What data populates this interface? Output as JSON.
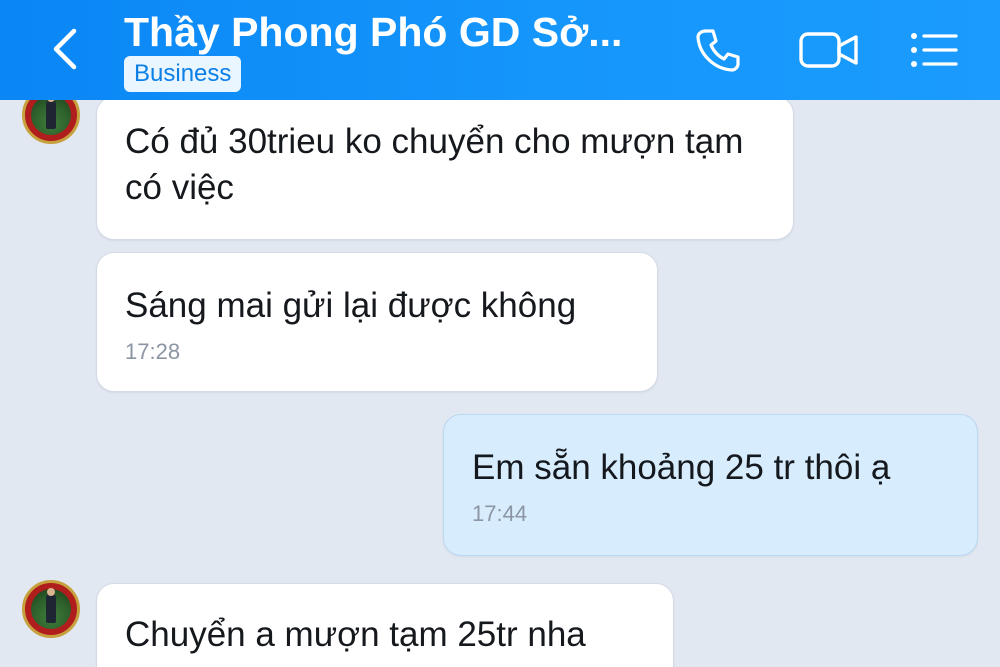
{
  "header": {
    "title": "Thầy Phong Phó GD Sở...",
    "badge": "Business",
    "back_icon": "chevron-left-icon",
    "call_icon": "phone-icon",
    "video_icon": "video-camera-icon",
    "menu_icon": "list-menu-icon"
  },
  "colors": {
    "header_blue": "#0a86f5",
    "chat_background": "#e2e8f1",
    "incoming_bubble": "#ffffff",
    "outgoing_bubble": "#d7ecfd"
  },
  "messages": [
    {
      "from": "contact",
      "text": "Có đủ 30trieu ko chuyển cho mượn tạm có việc",
      "time": ""
    },
    {
      "from": "contact",
      "text": "Sáng mai gửi lại được không",
      "time": "17:28"
    },
    {
      "from": "me",
      "text": "Em sẵn khoảng 25 tr thôi ạ",
      "time": "17:44"
    },
    {
      "from": "contact",
      "text": "Chuyển a mượn tạm 25tr nha",
      "time": ""
    }
  ]
}
